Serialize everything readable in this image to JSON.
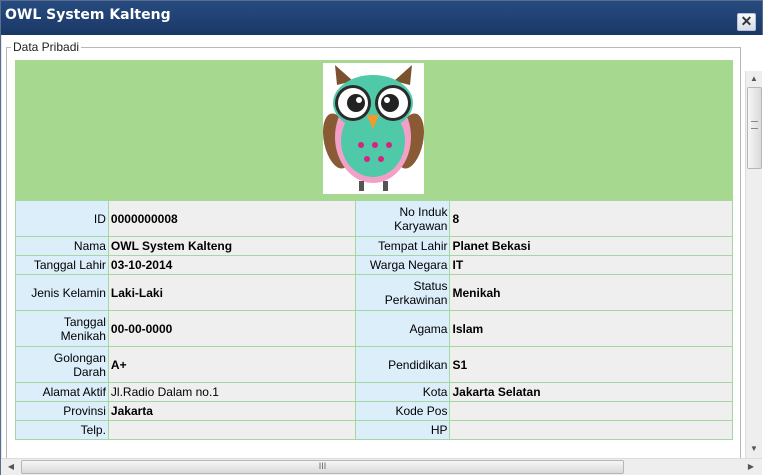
{
  "window": {
    "title": "OWL System Kalteng",
    "close_label": "x"
  },
  "section": {
    "legend": "Data Pribadi"
  },
  "photo": {
    "alt": "owl-avatar"
  },
  "rows": [
    {
      "l1": "ID",
      "v1": "0000000008",
      "l2": "No Induk Karyawan",
      "v2": "8"
    },
    {
      "l1": "Nama",
      "v1": "OWL System Kalteng",
      "l2": "Tempat Lahir",
      "v2": "Planet Bekasi"
    },
    {
      "l1": "Tanggal Lahir",
      "v1": "03-10-2014",
      "l2": "Warga Negara",
      "v2": "IT"
    },
    {
      "l1": "Jenis Kelamin",
      "v1": "Laki-Laki",
      "l2": "Status Perkawinan",
      "v2": "Menikah"
    },
    {
      "l1": "Tanggal Menikah",
      "v1": "00-00-0000",
      "l2": "Agama",
      "v2": "Islam"
    },
    {
      "l1": "Golongan Darah",
      "v1": "A+",
      "l2": "Pendidikan",
      "v2": "S1"
    },
    {
      "l1": "Alamat Aktif",
      "v1": "Jl.Radio Dalam no.1",
      "l2": "Kota",
      "v2": "Jakarta Selatan"
    },
    {
      "l1": "Provinsi",
      "v1": "Jakarta",
      "l2": "Kode Pos",
      "v2": ""
    },
    {
      "l1": "Telp.",
      "v1": "",
      "l2": "HP",
      "v2": ""
    }
  ],
  "scroll": {
    "h_grip": "III"
  },
  "colors": {
    "titlebar": "#1f4272",
    "photo_bg": "#a6d98f",
    "label_bg": "#dbeefa",
    "value_bg": "#efefef",
    "border": "#a5d7a5"
  }
}
